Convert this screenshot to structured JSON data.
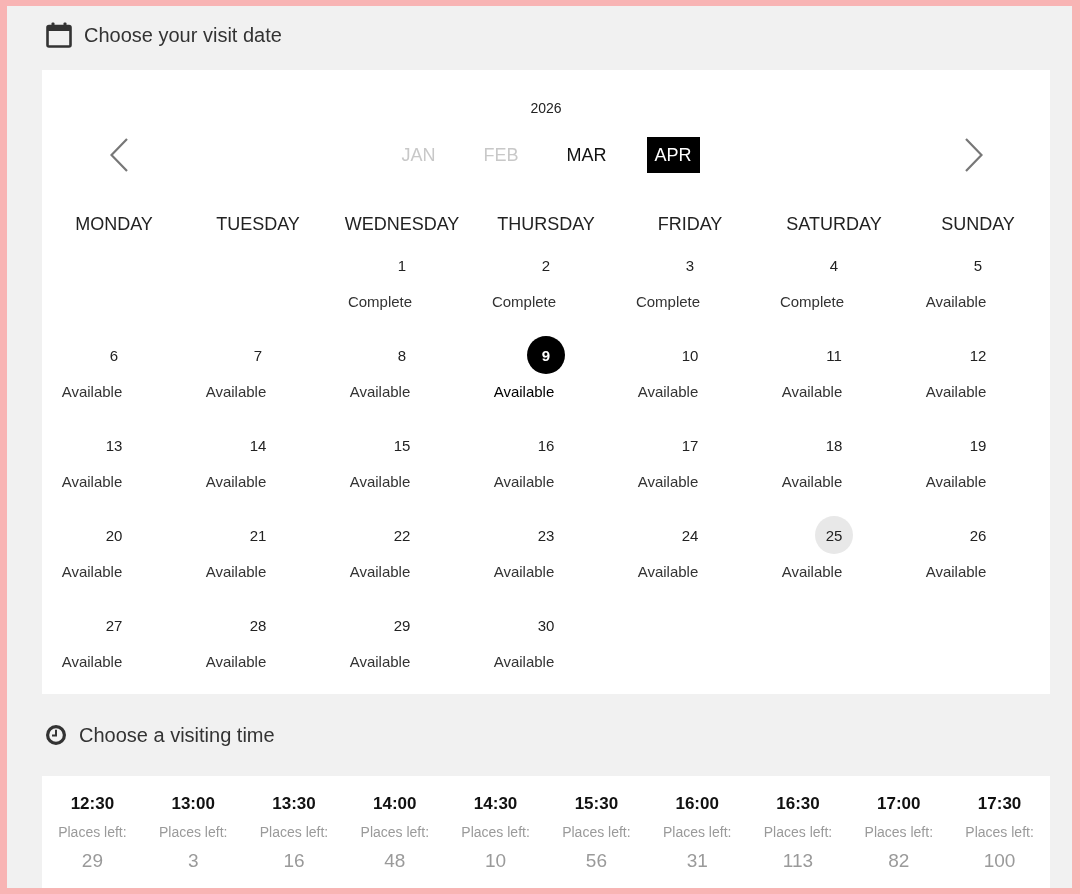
{
  "date_section": {
    "heading": "Choose your visit date",
    "calendar": {
      "year": "2026",
      "months": [
        {
          "label": "JAN",
          "disabled": true,
          "selected": false
        },
        {
          "label": "FEB",
          "disabled": true,
          "selected": false
        },
        {
          "label": "MAR",
          "disabled": false,
          "selected": false
        },
        {
          "label": "APR",
          "disabled": false,
          "selected": true
        }
      ],
      "weekdays": [
        "MONDAY",
        "TUESDAY",
        "WEDNESDAY",
        "THURSDAY",
        "FRIDAY",
        "SATURDAY",
        "SUNDAY"
      ],
      "days": [
        {
          "kind": "empty"
        },
        {
          "kind": "empty"
        },
        {
          "kind": "day",
          "number": "1",
          "status": "Complete",
          "selected": false,
          "highlighted": false
        },
        {
          "kind": "day",
          "number": "2",
          "status": "Complete",
          "selected": false,
          "highlighted": false
        },
        {
          "kind": "day",
          "number": "3",
          "status": "Complete",
          "selected": false,
          "highlighted": false
        },
        {
          "kind": "day",
          "number": "4",
          "status": "Complete",
          "selected": false,
          "highlighted": false
        },
        {
          "kind": "day",
          "number": "5",
          "status": "Available",
          "selected": false,
          "highlighted": false
        },
        {
          "kind": "day",
          "number": "6",
          "status": "Available",
          "selected": false,
          "highlighted": false
        },
        {
          "kind": "day",
          "number": "7",
          "status": "Available",
          "selected": false,
          "highlighted": false
        },
        {
          "kind": "day",
          "number": "8",
          "status": "Available",
          "selected": false,
          "highlighted": false
        },
        {
          "kind": "day",
          "number": "9",
          "status": "Available",
          "selected": true,
          "highlighted": false
        },
        {
          "kind": "day",
          "number": "10",
          "status": "Available",
          "selected": false,
          "highlighted": false
        },
        {
          "kind": "day",
          "number": "11",
          "status": "Available",
          "selected": false,
          "highlighted": false
        },
        {
          "kind": "day",
          "number": "12",
          "status": "Available",
          "selected": false,
          "highlighted": false
        },
        {
          "kind": "day",
          "number": "13",
          "status": "Available",
          "selected": false,
          "highlighted": false
        },
        {
          "kind": "day",
          "number": "14",
          "status": "Available",
          "selected": false,
          "highlighted": false
        },
        {
          "kind": "day",
          "number": "15",
          "status": "Available",
          "selected": false,
          "highlighted": false
        },
        {
          "kind": "day",
          "number": "16",
          "status": "Available",
          "selected": false,
          "highlighted": false
        },
        {
          "kind": "day",
          "number": "17",
          "status": "Available",
          "selected": false,
          "highlighted": false
        },
        {
          "kind": "day",
          "number": "18",
          "status": "Available",
          "selected": false,
          "highlighted": false
        },
        {
          "kind": "day",
          "number": "19",
          "status": "Available",
          "selected": false,
          "highlighted": false
        },
        {
          "kind": "day",
          "number": "20",
          "status": "Available",
          "selected": false,
          "highlighted": false
        },
        {
          "kind": "day",
          "number": "21",
          "status": "Available",
          "selected": false,
          "highlighted": false
        },
        {
          "kind": "day",
          "number": "22",
          "status": "Available",
          "selected": false,
          "highlighted": false
        },
        {
          "kind": "day",
          "number": "23",
          "status": "Available",
          "selected": false,
          "highlighted": false
        },
        {
          "kind": "day",
          "number": "24",
          "status": "Available",
          "selected": false,
          "highlighted": false
        },
        {
          "kind": "day",
          "number": "25",
          "status": "Available",
          "selected": false,
          "highlighted": true
        },
        {
          "kind": "day",
          "number": "26",
          "status": "Available",
          "selected": false,
          "highlighted": false
        },
        {
          "kind": "day",
          "number": "27",
          "status": "Available",
          "selected": false,
          "highlighted": false
        },
        {
          "kind": "day",
          "number": "28",
          "status": "Available",
          "selected": false,
          "highlighted": false
        },
        {
          "kind": "day",
          "number": "29",
          "status": "Available",
          "selected": false,
          "highlighted": false
        },
        {
          "kind": "day",
          "number": "30",
          "status": "Available",
          "selected": false,
          "highlighted": false
        }
      ]
    }
  },
  "time_section": {
    "heading": "Choose a visiting time",
    "slots": [
      {
        "time": "12:30",
        "label": "Places left:",
        "count": "29"
      },
      {
        "time": "13:00",
        "label": "Places left:",
        "count": "3"
      },
      {
        "time": "13:30",
        "label": "Places left:",
        "count": "16"
      },
      {
        "time": "14:00",
        "label": "Places left:",
        "count": "48"
      },
      {
        "time": "14:30",
        "label": "Places left:",
        "count": "10"
      },
      {
        "time": "15:30",
        "label": "Places left:",
        "count": "56"
      },
      {
        "time": "16:00",
        "label": "Places left:",
        "count": "31"
      },
      {
        "time": "16:30",
        "label": "Places left:",
        "count": "113"
      },
      {
        "time": "17:00",
        "label": "Places left:",
        "count": "82"
      },
      {
        "time": "17:30",
        "label": "Places left:",
        "count": "100"
      }
    ]
  }
}
